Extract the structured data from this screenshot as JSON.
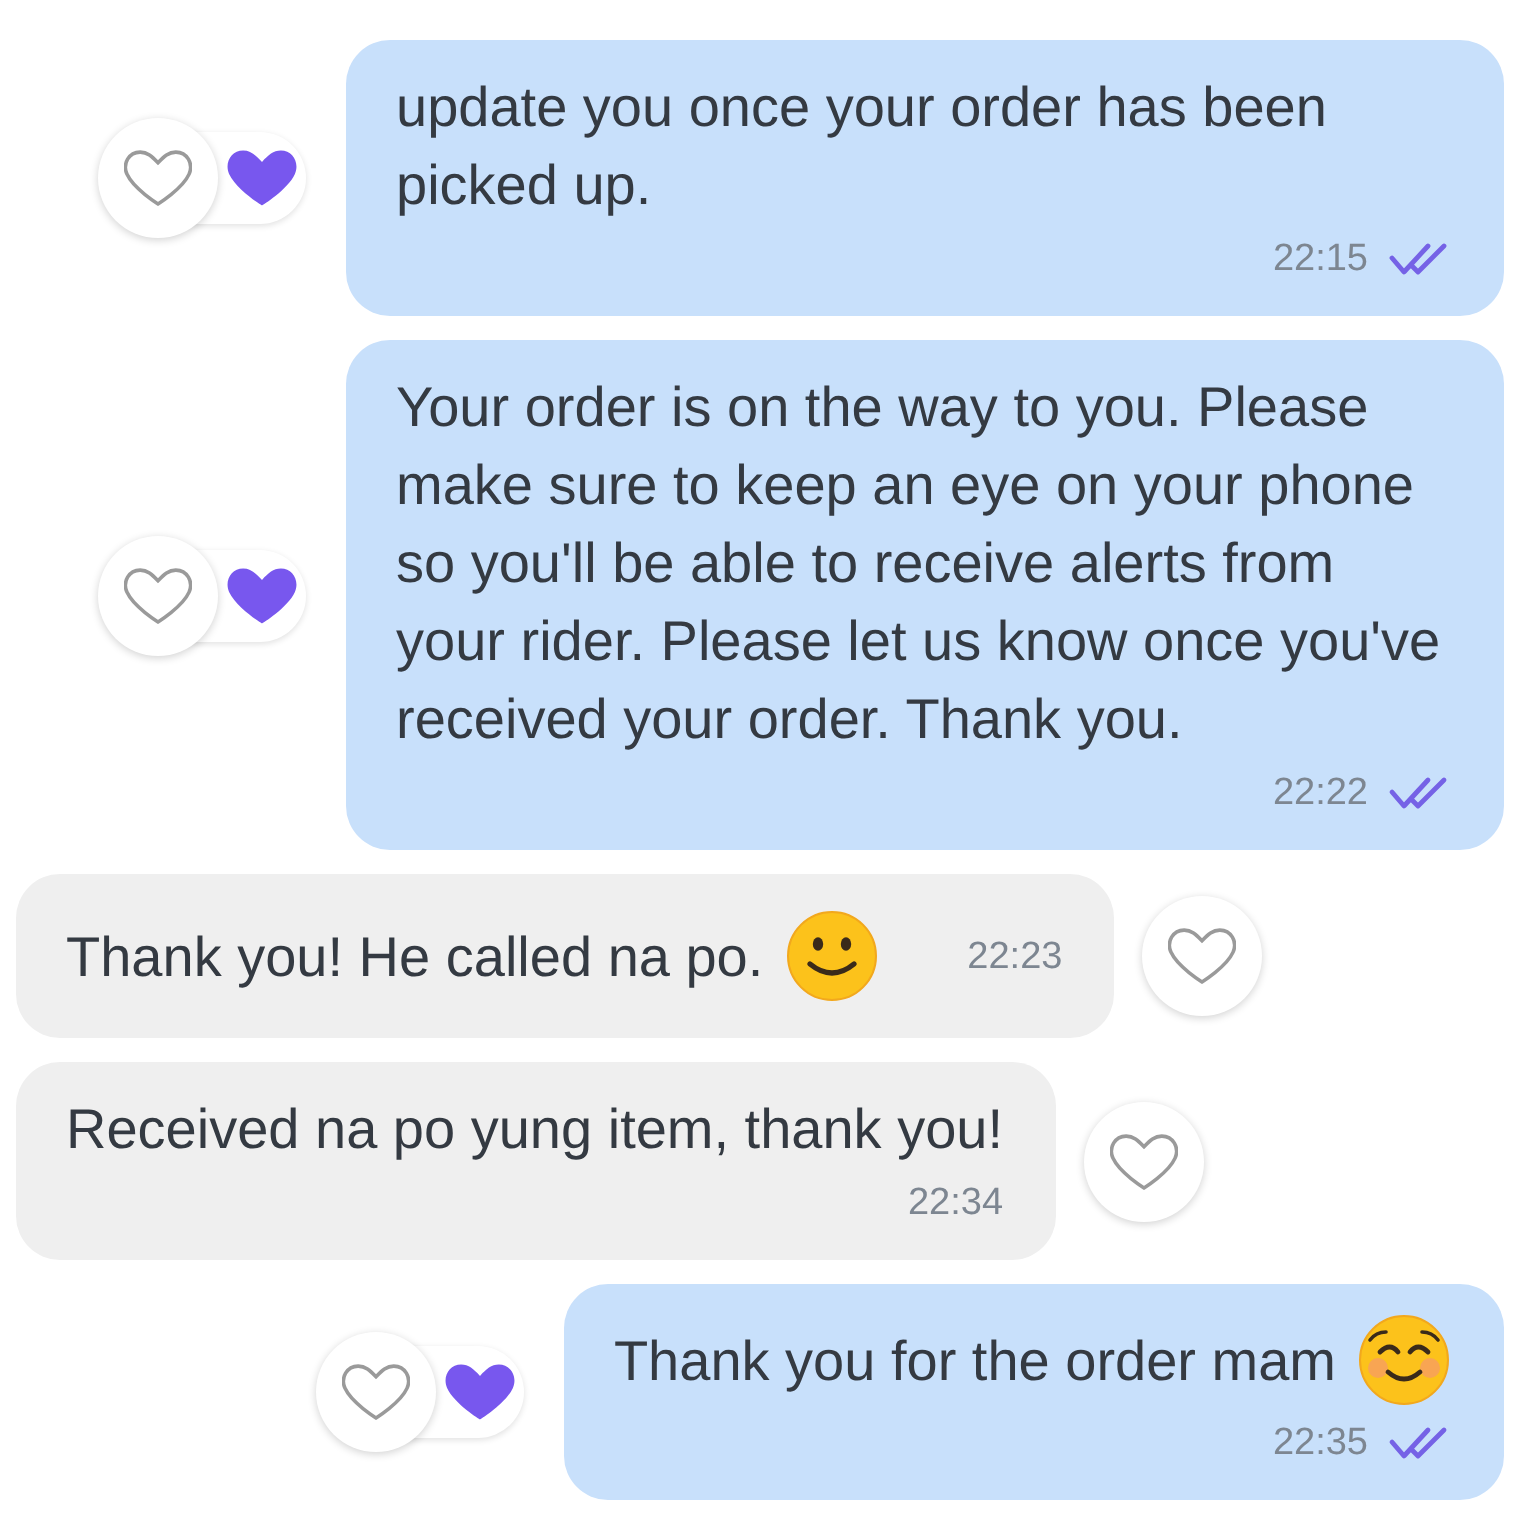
{
  "messages": [
    {
      "kind": "outgoing",
      "text": "update you once your order has been picked up.",
      "time": "22:15",
      "read": true,
      "time_inline": false,
      "reactions": {
        "liked": true
      }
    },
    {
      "kind": "outgoing",
      "text": "Your order is on the way to you. Please make sure to keep an eye on your phone so you'll be able to receive alerts from your rider. Please let us know once you've received your order. Thank you.",
      "time": "22:22",
      "read": true,
      "time_inline": false,
      "reactions": {
        "liked": true
      }
    },
    {
      "kind": "incoming",
      "text": "Thank you! He called na po.",
      "emoji": {
        "kind": "smile"
      },
      "time": "22:23",
      "time_inline": true,
      "reactions": {
        "liked": false
      }
    },
    {
      "kind": "incoming",
      "text": "Received na po yung item, thank you!",
      "time": "22:34",
      "time_inline": false,
      "reactions": {
        "liked": false
      }
    },
    {
      "kind": "outgoing",
      "text": "Thank you for the order mam",
      "emoji": {
        "kind": "blush"
      },
      "time": "22:35",
      "read": true,
      "time_inline": false,
      "reactions": {
        "liked": true
      }
    }
  ]
}
